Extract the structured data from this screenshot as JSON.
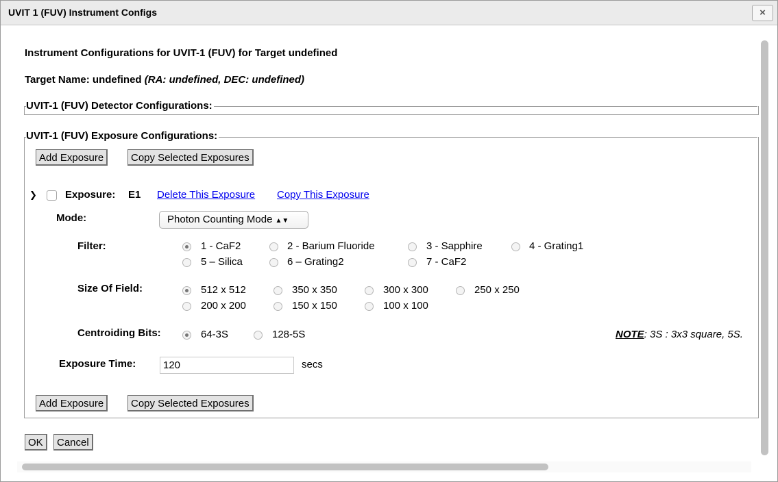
{
  "window": {
    "title": "UVIT 1 (FUV) Instrument Configs",
    "close_label": "×"
  },
  "header": {
    "title": "Instrument Configurations for UVIT-1 (FUV) for Target undefined",
    "target_name_label": "Target Name: undefined",
    "target_coords": "(RA: undefined, DEC: undefined)"
  },
  "detector_section": {
    "legend": "UVIT-1 (FUV) Detector Configurations:"
  },
  "exposure_section": {
    "legend": "UVIT-1 (FUV) Exposure Configurations:",
    "add_exposure_label": "Add Exposure",
    "copy_selected_label": "Copy Selected Exposures"
  },
  "exposure": {
    "label": "Exposure:",
    "id": "E1",
    "delete_link": "Delete This Exposure",
    "copy_link": "Copy This Exposure",
    "mode_label": "Mode:",
    "mode_value": "Photon Counting Mode",
    "filter_label": "Filter:",
    "filter_options": [
      "1 - CaF2",
      "2 - Barium Fluoride",
      "3 - Sapphire",
      "4 - Grating1",
      "5 – Silica",
      "6 – Grating2",
      "7 - CaF2"
    ],
    "filter_selected": "1 - CaF2",
    "size_label": "Size Of Field:",
    "size_options": [
      "512 x 512",
      "350 x 350",
      "300 x 300",
      "250 x 250",
      "200 x 200",
      "150 x 150",
      "100 x 100"
    ],
    "size_selected": "512 x 512",
    "centroid_label": "Centroiding Bits:",
    "centroid_options": [
      "64-3S",
      "128-5S"
    ],
    "centroid_selected": "64-3S",
    "note_head": "NOTE",
    "note_text": ": 3S : 3x3 square, 5S.",
    "exposure_time_label": "Exposure Time:",
    "exposure_time_value": "120",
    "exposure_time_unit": "secs"
  },
  "footer": {
    "ok_label": "OK",
    "cancel_label": "Cancel"
  }
}
